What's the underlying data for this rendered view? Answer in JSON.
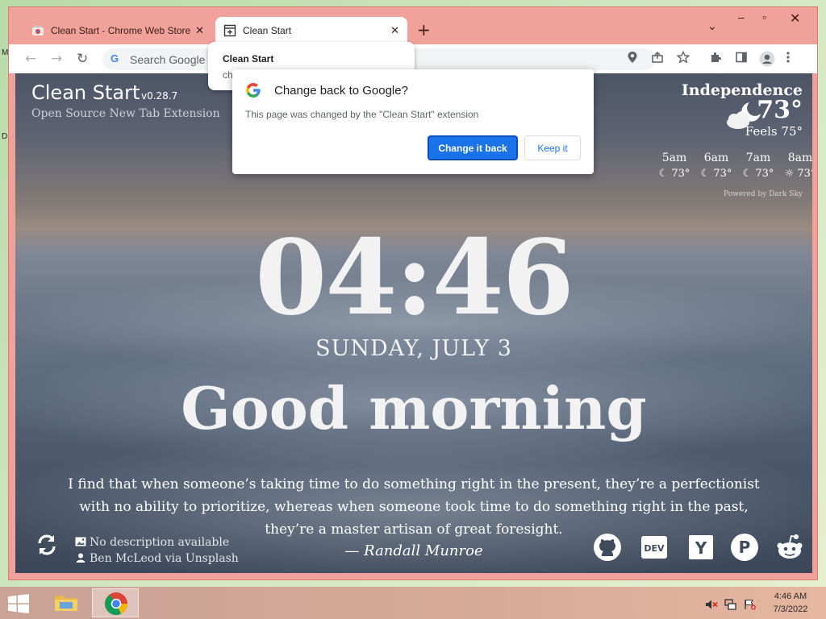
{
  "desktop": {
    "edge_label_top": "M",
    "edge_label_mid": "D"
  },
  "browser": {
    "tabs": [
      {
        "label": "Clean Start - Chrome Web Store",
        "close": "✕"
      },
      {
        "label": "Clean Start",
        "close": "✕"
      }
    ],
    "new_tab": "+",
    "tab_search": "⌄",
    "window_controls": {
      "minimize": "–",
      "maximize": "▫",
      "close": "✕"
    },
    "toolbar": {
      "back": "←",
      "forward": "→",
      "reload": "↻",
      "omnibox_g": "G",
      "omnibox_text": "Search Google o"
    },
    "hover_card": {
      "title": "Clean Start",
      "subtitle": "ch"
    }
  },
  "bubble": {
    "title": "Change back to Google?",
    "body": "This page was changed by the \"Clean Start\" extension",
    "primary_button": "Change it back",
    "secondary_button": "Keep it"
  },
  "page": {
    "brand_title": "Clean Start",
    "brand_version": "v0.28.7",
    "brand_subtitle": "Open Source New Tab Extension",
    "weather": {
      "city": "Independence",
      "temp": "73°",
      "feels": "Feels 75°",
      "hours": [
        {
          "time": "5am",
          "temp": "73°"
        },
        {
          "time": "6am",
          "temp": "73°"
        },
        {
          "time": "7am",
          "temp": "73°"
        },
        {
          "time": "8am",
          "temp": "73°"
        }
      ],
      "powered_by": "Powered by Dark Sky"
    },
    "clock": "04:46",
    "date": "SUNDAY, JULY 3",
    "greeting": "Good morning",
    "quote": "I find that when someone’s taking time to do something right in the present, they’re a perfectionist with no ability to prioritize, whereas when someone took time to do something right in the past, they’re a master artisan of great foresight.",
    "author": "— Randall Munroe",
    "photo_description": "No description available",
    "photo_credit": "Ben McLeod via Unsplash",
    "site_links": {
      "dev": "DEV",
      "yc": "Y",
      "ph": "P"
    }
  },
  "taskbar": {
    "time": "4:46 AM",
    "date": "7/3/2022"
  }
}
